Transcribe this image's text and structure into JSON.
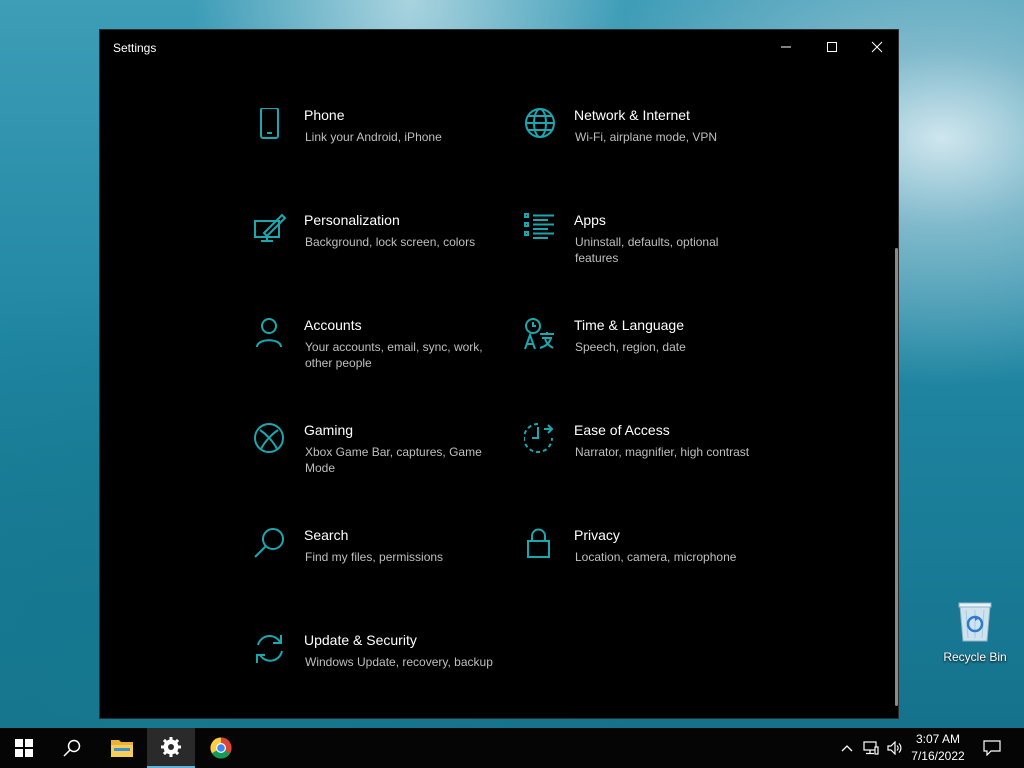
{
  "window": {
    "title": "Settings",
    "accent": "#1aa8b0"
  },
  "tiles": [
    {
      "icon": "phone-icon",
      "title": "Phone",
      "desc": "Link your Android, iPhone"
    },
    {
      "icon": "globe-icon",
      "title": "Network & Internet",
      "desc": "Wi-Fi, airplane mode, VPN"
    },
    {
      "icon": "personalization-icon",
      "title": "Personalization",
      "desc": "Background, lock screen, colors"
    },
    {
      "icon": "apps-list-icon",
      "title": "Apps",
      "desc": "Uninstall, defaults, optional features"
    },
    {
      "icon": "person-icon",
      "title": "Accounts",
      "desc": "Your accounts, email, sync, work, other people"
    },
    {
      "icon": "time-language-icon",
      "title": "Time & Language",
      "desc": "Speech, region, date"
    },
    {
      "icon": "xbox-icon",
      "title": "Gaming",
      "desc": "Xbox Game Bar, captures, Game Mode"
    },
    {
      "icon": "ease-of-access-icon",
      "title": "Ease of Access",
      "desc": "Narrator, magnifier, high contrast"
    },
    {
      "icon": "search-icon",
      "title": "Search",
      "desc": "Find my files, permissions"
    },
    {
      "icon": "lock-icon",
      "title": "Privacy",
      "desc": "Location, camera, microphone"
    },
    {
      "icon": "sync-icon",
      "title": "Update & Security",
      "desc": "Windows Update, recovery, backup"
    }
  ],
  "desktop": {
    "recycle_bin_label": "Recycle Bin"
  },
  "taskbar": {
    "pinned": [
      "windows-start-icon",
      "search-icon",
      "file-explorer-icon",
      "settings-gear-icon",
      "chrome-icon"
    ],
    "active": "settings-gear-icon",
    "time": "3:07 AM",
    "date": "7/16/2022"
  }
}
